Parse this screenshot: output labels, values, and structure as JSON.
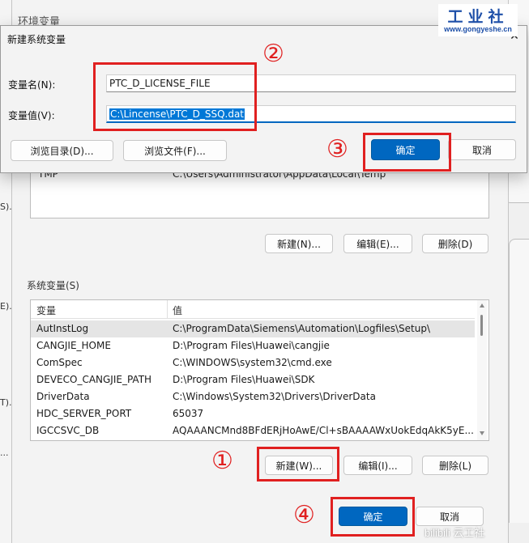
{
  "watermark": {
    "site_name": "工业社",
    "url": "www.gongyeshe.cn",
    "bottom": "bilibili  云工社"
  },
  "env_window": {
    "title": "环境变量",
    "user_group": {
      "row": {
        "name": "TMP",
        "value": "C:\\Users\\Administrator\\AppData\\Local\\Temp"
      },
      "buttons": {
        "new": "新建(N)...",
        "edit": "编辑(E)...",
        "delete": "删除(D)"
      }
    },
    "system_group": {
      "label": "系统变量(S)",
      "columns": [
        "变量",
        "值"
      ],
      "rows": [
        {
          "name": "AutInstLog",
          "value": "C:\\ProgramData\\Siemens\\Automation\\Logfiles\\Setup\\"
        },
        {
          "name": "CANGJIE_HOME",
          "value": "D:\\Program Files\\Huawei\\cangjie"
        },
        {
          "name": "ComSpec",
          "value": "C:\\WINDOWS\\system32\\cmd.exe"
        },
        {
          "name": "DEVECO_CANGJIE_PATH",
          "value": "D:\\Program Files\\Huawei\\SDK"
        },
        {
          "name": "DriverData",
          "value": "C:\\Windows\\System32\\Drivers\\DriverData"
        },
        {
          "name": "HDC_SERVER_PORT",
          "value": "65037"
        },
        {
          "name": "IGCCSVC_DB",
          "value": "AQAAANCMnd8BFdERjHoAwE/Cl+sBAAAAWxUokEdqAkK5yE..."
        }
      ],
      "buttons": {
        "new": "新建(W)...",
        "edit": "编辑(I)...",
        "delete": "删除(L)"
      }
    },
    "footer": {
      "ok": "确定",
      "cancel": "取消"
    }
  },
  "left_fragments": [
    "S).",
    "E).",
    "T).",
    "..."
  ],
  "dialog": {
    "title": "新建系统变量",
    "name_label": "变量名(N):",
    "name_value": "PTC_D_LICENSE_FILE",
    "value_label": "变量值(V):",
    "value_value": "C:\\Lincense\\PTC_D_SSQ.dat",
    "browse_dir": "浏览目录(D)...",
    "browse_file": "浏览文件(F)...",
    "ok": "确定",
    "cancel": "取消"
  },
  "annotations": [
    "①",
    "②",
    "③",
    "④"
  ],
  "colors": {
    "accent": "#0067c0",
    "annotation": "#e02020"
  }
}
